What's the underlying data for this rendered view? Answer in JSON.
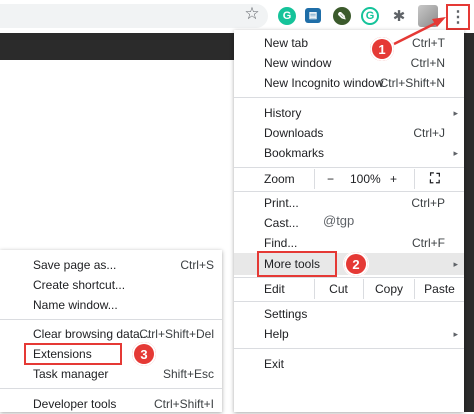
{
  "toolbar": {
    "icons": [
      "star-icon",
      "grammarly-icon",
      "extension-square-icon",
      "leaf-icon",
      "grammarly-g-icon",
      "puzzle-icon",
      "avatar",
      "kebab-menu-icon"
    ],
    "star_glyph": "☆",
    "kebab_glyph": "⋮",
    "puzzle_glyph": "✱",
    "grammarly_glyph": "G",
    "g2_glyph": "G",
    "square_glyph": "▤",
    "leaf_glyph": "✎"
  },
  "menu": {
    "new_tab": {
      "label": "New tab",
      "shortcut": "Ctrl+T"
    },
    "new_window": {
      "label": "New window",
      "shortcut": "Ctrl+N"
    },
    "new_incognito": {
      "label": "New Incognito window",
      "shortcut": "Ctrl+Shift+N"
    },
    "history": {
      "label": "History",
      "arrow": "▸"
    },
    "downloads": {
      "label": "Downloads",
      "shortcut": "Ctrl+J"
    },
    "bookmarks": {
      "label": "Bookmarks",
      "arrow": "▸"
    },
    "zoom": {
      "label": "Zoom",
      "minus": "−",
      "level": "100%",
      "plus": "+",
      "fullscreen": "⛶"
    },
    "print": {
      "label": "Print...",
      "shortcut": "Ctrl+P"
    },
    "cast": {
      "label": "Cast..."
    },
    "find": {
      "label": "Find...",
      "shortcut": "Ctrl+F"
    },
    "more_tools": {
      "label": "More tools",
      "arrow": "▸"
    },
    "edit": {
      "label": "Edit",
      "cut": "Cut",
      "copy": "Copy",
      "paste": "Paste"
    },
    "settings": {
      "label": "Settings"
    },
    "help": {
      "label": "Help",
      "arrow": "▸"
    },
    "exit": {
      "label": "Exit"
    }
  },
  "watermark": "@tgp",
  "submenu": {
    "save_page": {
      "label": "Save page as...",
      "shortcut": "Ctrl+S"
    },
    "create_shortcut": {
      "label": "Create shortcut..."
    },
    "name_window": {
      "label": "Name window..."
    },
    "clear_browsing": {
      "label": "Clear browsing data...",
      "shortcut": "Ctrl+Shift+Del"
    },
    "extensions": {
      "label": "Extensions"
    },
    "task_manager": {
      "label": "Task manager",
      "shortcut": "Shift+Esc"
    },
    "developer_tools": {
      "label": "Developer tools",
      "shortcut": "Ctrl+Shift+I"
    }
  },
  "annotations": {
    "step1": "1",
    "step2": "2",
    "step3": "3",
    "color": "#e53935"
  }
}
